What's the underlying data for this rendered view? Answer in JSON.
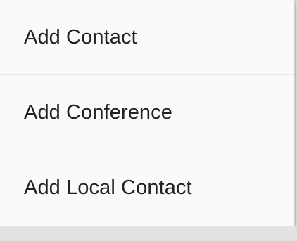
{
  "menu": {
    "items": [
      {
        "label": "Add Contact"
      },
      {
        "label": "Add Conference"
      },
      {
        "label": "Add Local Contact"
      }
    ]
  },
  "colors": {
    "menu_background": "#fafafa",
    "text": "#212121",
    "divider": "#e7e7e7",
    "backdrop": "#e4e4e4"
  }
}
